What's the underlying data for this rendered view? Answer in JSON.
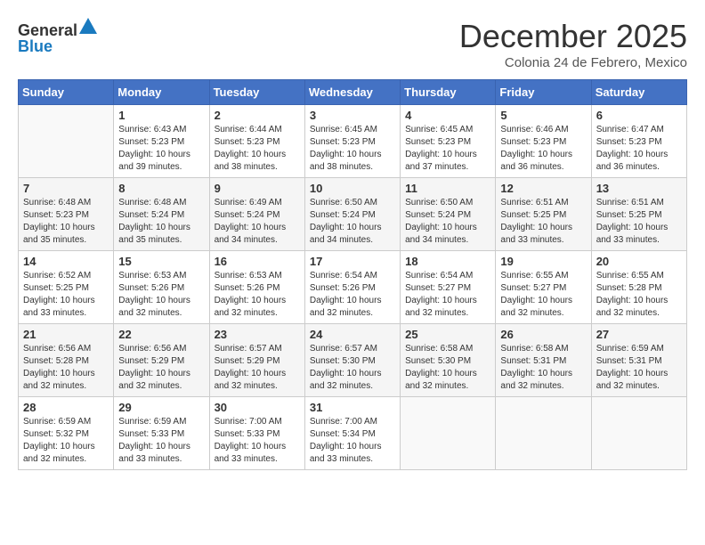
{
  "header": {
    "logo_general": "General",
    "logo_blue": "Blue",
    "month_title": "December 2025",
    "location": "Colonia 24 de Febrero, Mexico"
  },
  "days_of_week": [
    "Sunday",
    "Monday",
    "Tuesday",
    "Wednesday",
    "Thursday",
    "Friday",
    "Saturday"
  ],
  "weeks": [
    [
      {
        "day": "",
        "info": ""
      },
      {
        "day": "1",
        "info": "Sunrise: 6:43 AM\nSunset: 5:23 PM\nDaylight: 10 hours\nand 39 minutes."
      },
      {
        "day": "2",
        "info": "Sunrise: 6:44 AM\nSunset: 5:23 PM\nDaylight: 10 hours\nand 38 minutes."
      },
      {
        "day": "3",
        "info": "Sunrise: 6:45 AM\nSunset: 5:23 PM\nDaylight: 10 hours\nand 38 minutes."
      },
      {
        "day": "4",
        "info": "Sunrise: 6:45 AM\nSunset: 5:23 PM\nDaylight: 10 hours\nand 37 minutes."
      },
      {
        "day": "5",
        "info": "Sunrise: 6:46 AM\nSunset: 5:23 PM\nDaylight: 10 hours\nand 36 minutes."
      },
      {
        "day": "6",
        "info": "Sunrise: 6:47 AM\nSunset: 5:23 PM\nDaylight: 10 hours\nand 36 minutes."
      }
    ],
    [
      {
        "day": "7",
        "info": "Sunrise: 6:48 AM\nSunset: 5:23 PM\nDaylight: 10 hours\nand 35 minutes."
      },
      {
        "day": "8",
        "info": "Sunrise: 6:48 AM\nSunset: 5:24 PM\nDaylight: 10 hours\nand 35 minutes."
      },
      {
        "day": "9",
        "info": "Sunrise: 6:49 AM\nSunset: 5:24 PM\nDaylight: 10 hours\nand 34 minutes."
      },
      {
        "day": "10",
        "info": "Sunrise: 6:50 AM\nSunset: 5:24 PM\nDaylight: 10 hours\nand 34 minutes."
      },
      {
        "day": "11",
        "info": "Sunrise: 6:50 AM\nSunset: 5:24 PM\nDaylight: 10 hours\nand 34 minutes."
      },
      {
        "day": "12",
        "info": "Sunrise: 6:51 AM\nSunset: 5:25 PM\nDaylight: 10 hours\nand 33 minutes."
      },
      {
        "day": "13",
        "info": "Sunrise: 6:51 AM\nSunset: 5:25 PM\nDaylight: 10 hours\nand 33 minutes."
      }
    ],
    [
      {
        "day": "14",
        "info": "Sunrise: 6:52 AM\nSunset: 5:25 PM\nDaylight: 10 hours\nand 33 minutes."
      },
      {
        "day": "15",
        "info": "Sunrise: 6:53 AM\nSunset: 5:26 PM\nDaylight: 10 hours\nand 32 minutes."
      },
      {
        "day": "16",
        "info": "Sunrise: 6:53 AM\nSunset: 5:26 PM\nDaylight: 10 hours\nand 32 minutes."
      },
      {
        "day": "17",
        "info": "Sunrise: 6:54 AM\nSunset: 5:26 PM\nDaylight: 10 hours\nand 32 minutes."
      },
      {
        "day": "18",
        "info": "Sunrise: 6:54 AM\nSunset: 5:27 PM\nDaylight: 10 hours\nand 32 minutes."
      },
      {
        "day": "19",
        "info": "Sunrise: 6:55 AM\nSunset: 5:27 PM\nDaylight: 10 hours\nand 32 minutes."
      },
      {
        "day": "20",
        "info": "Sunrise: 6:55 AM\nSunset: 5:28 PM\nDaylight: 10 hours\nand 32 minutes."
      }
    ],
    [
      {
        "day": "21",
        "info": "Sunrise: 6:56 AM\nSunset: 5:28 PM\nDaylight: 10 hours\nand 32 minutes."
      },
      {
        "day": "22",
        "info": "Sunrise: 6:56 AM\nSunset: 5:29 PM\nDaylight: 10 hours\nand 32 minutes."
      },
      {
        "day": "23",
        "info": "Sunrise: 6:57 AM\nSunset: 5:29 PM\nDaylight: 10 hours\nand 32 minutes."
      },
      {
        "day": "24",
        "info": "Sunrise: 6:57 AM\nSunset: 5:30 PM\nDaylight: 10 hours\nand 32 minutes."
      },
      {
        "day": "25",
        "info": "Sunrise: 6:58 AM\nSunset: 5:30 PM\nDaylight: 10 hours\nand 32 minutes."
      },
      {
        "day": "26",
        "info": "Sunrise: 6:58 AM\nSunset: 5:31 PM\nDaylight: 10 hours\nand 32 minutes."
      },
      {
        "day": "27",
        "info": "Sunrise: 6:59 AM\nSunset: 5:31 PM\nDaylight: 10 hours\nand 32 minutes."
      }
    ],
    [
      {
        "day": "28",
        "info": "Sunrise: 6:59 AM\nSunset: 5:32 PM\nDaylight: 10 hours\nand 32 minutes."
      },
      {
        "day": "29",
        "info": "Sunrise: 6:59 AM\nSunset: 5:33 PM\nDaylight: 10 hours\nand 33 minutes."
      },
      {
        "day": "30",
        "info": "Sunrise: 7:00 AM\nSunset: 5:33 PM\nDaylight: 10 hours\nand 33 minutes."
      },
      {
        "day": "31",
        "info": "Sunrise: 7:00 AM\nSunset: 5:34 PM\nDaylight: 10 hours\nand 33 minutes."
      },
      {
        "day": "",
        "info": ""
      },
      {
        "day": "",
        "info": ""
      },
      {
        "day": "",
        "info": ""
      }
    ]
  ]
}
